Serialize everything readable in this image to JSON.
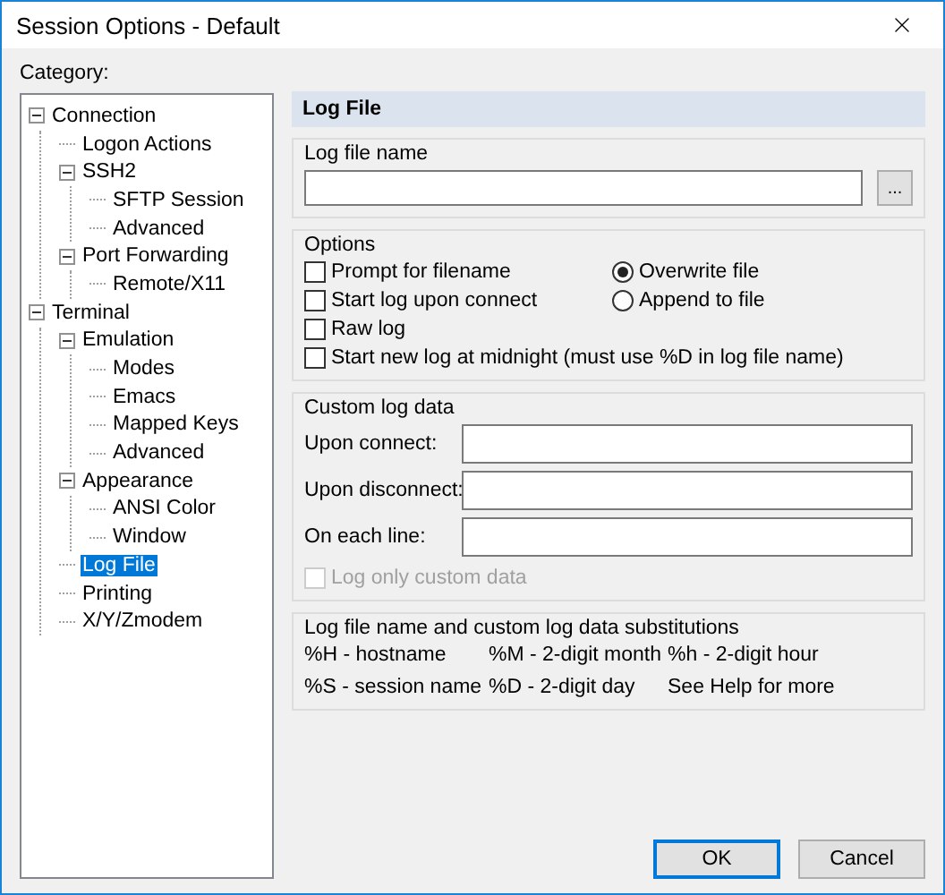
{
  "window": {
    "title": "Session Options - Default"
  },
  "category": {
    "label": "Category:",
    "tree": [
      {
        "label": "Connection",
        "expanded": true,
        "selected": false,
        "children": [
          {
            "label": "Logon Actions",
            "selected": false
          },
          {
            "label": "SSH2",
            "expanded": true,
            "selected": false,
            "children": [
              {
                "label": "SFTP Session",
                "selected": false
              },
              {
                "label": "Advanced",
                "selected": false
              }
            ]
          },
          {
            "label": "Port Forwarding",
            "expanded": true,
            "selected": false,
            "children": [
              {
                "label": "Remote/X11",
                "selected": false
              }
            ]
          }
        ]
      },
      {
        "label": "Terminal",
        "expanded": true,
        "selected": false,
        "children": [
          {
            "label": "Emulation",
            "expanded": true,
            "selected": false,
            "children": [
              {
                "label": "Modes",
                "selected": false
              },
              {
                "label": "Emacs",
                "selected": false
              },
              {
                "label": "Mapped Keys",
                "selected": false
              },
              {
                "label": "Advanced",
                "selected": false
              }
            ]
          },
          {
            "label": "Appearance",
            "expanded": true,
            "selected": false,
            "children": [
              {
                "label": "ANSI Color",
                "selected": false
              },
              {
                "label": "Window",
                "selected": false
              }
            ]
          },
          {
            "label": "Log File",
            "selected": true
          },
          {
            "label": "Printing",
            "selected": false
          },
          {
            "label": "X/Y/Zmodem",
            "selected": false
          }
        ]
      }
    ]
  },
  "panel": {
    "title": "Log File",
    "log_file_name": {
      "title": "Log file name",
      "browse": "..."
    },
    "options": {
      "title": "Options",
      "checkboxes": [
        {
          "label": "Prompt for filename",
          "checked": false
        },
        {
          "label": "Start log upon connect",
          "checked": false
        },
        {
          "label": "Raw log",
          "checked": false
        },
        {
          "label": "Start new log at midnight (must use %D in log file name)",
          "checked": false
        }
      ],
      "radios": [
        {
          "label": "Overwrite file",
          "selected": true
        },
        {
          "label": "Append to file",
          "selected": false
        }
      ]
    },
    "custom": {
      "title": "Custom log data",
      "fields": [
        {
          "label": "Upon connect:"
        },
        {
          "label": "Upon disconnect:"
        },
        {
          "label": "On each line:"
        }
      ],
      "only_custom": {
        "label": "Log only custom data",
        "checked": false,
        "disabled": true
      }
    },
    "substitutions": {
      "title": "Log file name and custom log data substitutions",
      "items": [
        "%H - hostname",
        "%M - 2-digit month",
        "%h - 2-digit hour",
        "%S - session name",
        "%D - 2-digit day",
        "See Help for more"
      ]
    }
  },
  "buttons": [
    {
      "label": "OK",
      "default": true
    },
    {
      "label": "Cancel",
      "default": false
    }
  ]
}
